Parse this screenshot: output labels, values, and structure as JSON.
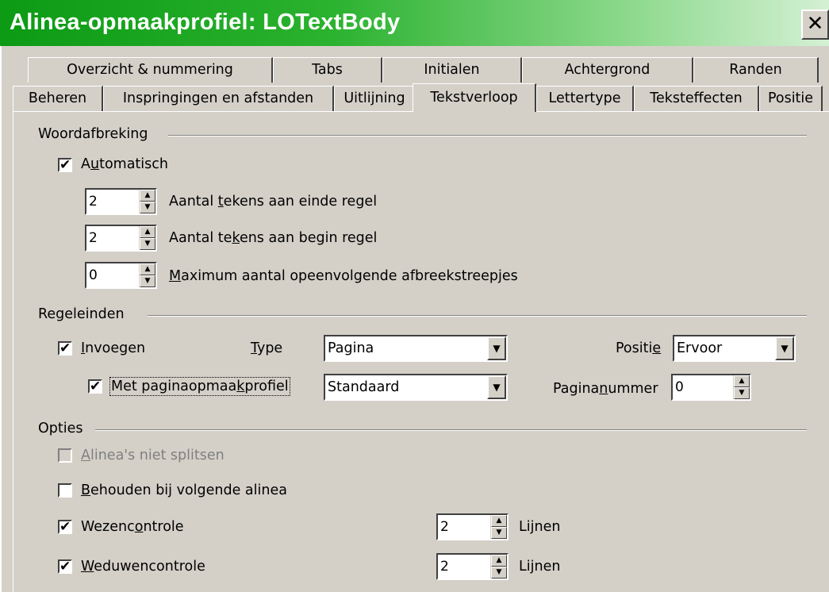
{
  "window": {
    "title": "Alinea-opmaakprofiel: LOTextBody",
    "close_symbol": "✕"
  },
  "tabs_row1": [
    {
      "label": "Overzicht & nummering"
    },
    {
      "label": "Tabs"
    },
    {
      "label": "Initialen"
    },
    {
      "label": "Achtergrond"
    },
    {
      "label": "Randen"
    }
  ],
  "tabs_row2": [
    {
      "label": "Beheren"
    },
    {
      "label": "Inspringingen en afstanden"
    },
    {
      "label": "Uitlijning"
    },
    {
      "label": "Tekstverloop",
      "active": true
    },
    {
      "label": "Lettertype"
    },
    {
      "label": "Teksteffecten"
    },
    {
      "label": "Positie"
    }
  ],
  "hyphenation": {
    "group_label": "Woordafbreking",
    "automatic": {
      "pre": "A",
      "u": "u",
      "post": "tomatisch",
      "checked": true
    },
    "chars_end": {
      "value": "2",
      "pre": "Aantal ",
      "u": "t",
      "post": "ekens aan einde regel"
    },
    "chars_begin": {
      "value": "2",
      "pre": "Aantal te",
      "u": "k",
      "post": "ens aan begin regel"
    },
    "max_hyphens": {
      "value": "0",
      "pre": "",
      "u": "M",
      "post": "aximum aantal opeenvolgende afbreekstreepjes"
    }
  },
  "breaks": {
    "group_label": "Regeleinden",
    "insert": {
      "pre": "",
      "u": "I",
      "post": "nvoegen",
      "checked": true
    },
    "type_label": {
      "pre": "",
      "u": "T",
      "post": "ype"
    },
    "type_value": "Pagina",
    "position_label": {
      "pre": "Positi",
      "u": "e",
      "post": ""
    },
    "position_value": "Ervoor",
    "with_page_style": {
      "pre": "Met paginaopmaa",
      "u": "k",
      "post": "profiel",
      "checked": true
    },
    "page_style_value": "Standaard",
    "page_number_label": {
      "pre": "Pagina",
      "u": "n",
      "post": "ummer"
    },
    "page_number_value": "0"
  },
  "options": {
    "group_label": "Opties",
    "dont_split": {
      "pre": "",
      "u": "A",
      "post": "linea's niet splitsen",
      "checked": false,
      "disabled": true
    },
    "keep_with_next": {
      "pre": "",
      "u": "B",
      "post": "ehouden bij volgende alinea",
      "checked": false
    },
    "orphan": {
      "pre": "Wezenc",
      "u": "o",
      "post": "ntrole",
      "checked": true,
      "value": "2",
      "unit": "Lijnen"
    },
    "widow": {
      "pre": "",
      "u": "W",
      "post": "eduwencontrole",
      "checked": true,
      "value": "2",
      "unit": "Lijnen"
    }
  },
  "icons": {
    "checkmark": "✔",
    "spin_up": "▲",
    "spin_down": "▼",
    "dropdown": "▼"
  },
  "colors": {
    "titlebar_start": "#0c9a14",
    "titlebar_end": "#d4f0d4",
    "dialog_bg": "#d4d0c8",
    "disabled_text": "#808080"
  }
}
